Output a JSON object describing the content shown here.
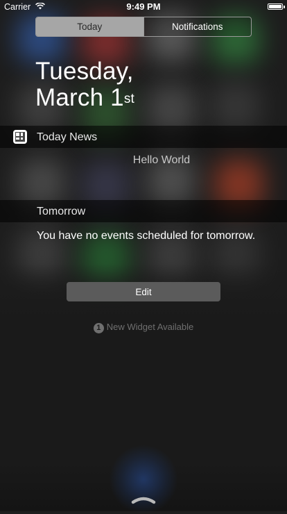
{
  "status_bar": {
    "carrier": "Carrier",
    "time": "9:49 PM",
    "wifi_icon": "wifi-icon",
    "battery_icon": "battery-icon",
    "battery_level": 1.0
  },
  "tabs": [
    {
      "label": "Today",
      "selected": true
    },
    {
      "label": "Notifications",
      "selected": false
    }
  ],
  "date": {
    "weekday": "Tuesday,",
    "month_day": "March 1",
    "ordinal_suffix": "st"
  },
  "widgets": {
    "today_news": {
      "title": "Today News",
      "icon": "calendar-grid-icon",
      "content": "Hello World"
    },
    "tomorrow": {
      "title": "Tomorrow",
      "content": "You have no events scheduled for tomorrow."
    }
  },
  "edit_label": "Edit",
  "new_widget": {
    "count": "1",
    "label": "New Widget Available"
  },
  "colors": {
    "segment_active_bg": "#a6a6a6",
    "header_bg": "rgba(0,0,0,0.55)",
    "edit_button_bg": "#5b5b5b",
    "muted_text": "#6f6f6f"
  }
}
